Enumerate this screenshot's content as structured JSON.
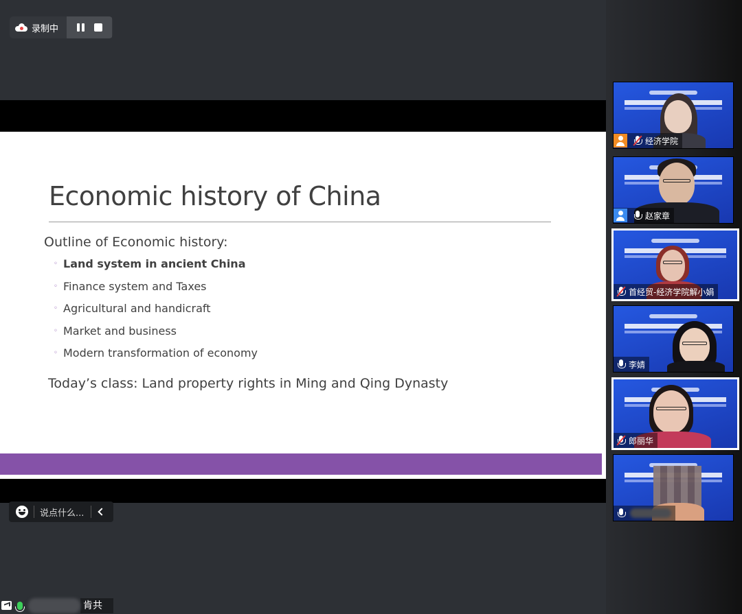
{
  "recording": {
    "label": "录制中"
  },
  "slide": {
    "title": "Economic history of China",
    "outline": "Outline of  Economic history:",
    "items": [
      {
        "text": "Land system in ancient China",
        "bold": true
      },
      {
        "text": "Finance system and Taxes",
        "bold": false
      },
      {
        "text": "Agricultural and handicraft",
        "bold": false
      },
      {
        "text": "Market and business",
        "bold": false
      },
      {
        "text": "Modern transformation of economy",
        "bold": false
      }
    ],
    "today": "Today’s class: Land property rights in Ming and Qing Dynasty",
    "accent": "#8552a8"
  },
  "chat": {
    "placeholder": "说点什么..."
  },
  "status": {
    "text": "肯共享"
  },
  "participants": [
    {
      "name": "经济学院",
      "mic": "muted",
      "role": "host"
    },
    {
      "name": "赵家章",
      "mic": "on",
      "role": "cohost"
    },
    {
      "name": "首经贸-经济学院解小娟",
      "mic": "muted",
      "role": ""
    },
    {
      "name": "李婧",
      "mic": "on",
      "role": ""
    },
    {
      "name": "郎丽华",
      "mic": "muted",
      "role": ""
    },
    {
      "name": "",
      "mic": "on",
      "role": ""
    }
  ]
}
